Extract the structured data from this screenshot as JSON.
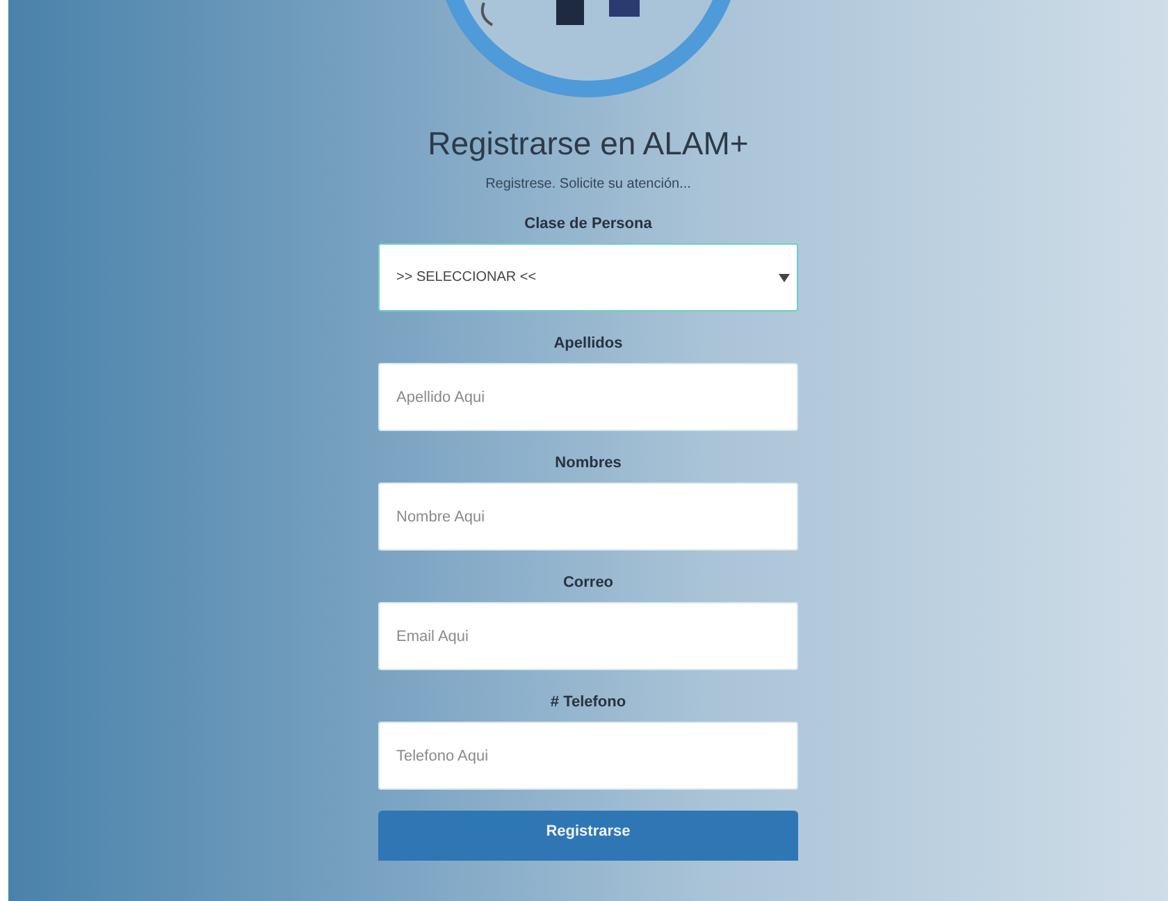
{
  "title": "Registrarse en ALAM+",
  "subtitle": "Registrese. Solicite su atención...",
  "fields": [
    {
      "label": "Clase de Persona",
      "kind": "select",
      "value": ">> SELECCIONAR <<"
    },
    {
      "label": "Apellidos",
      "kind": "input",
      "placeholder": "Apellido Aqui"
    },
    {
      "label": "Nombres",
      "kind": "input",
      "placeholder": "Nombre Aqui"
    },
    {
      "label": "Correo",
      "kind": "input",
      "placeholder": "Email Aqui"
    },
    {
      "label": "# Telefono",
      "kind": "input",
      "placeholder": "Telefono Aqui"
    }
  ],
  "button": "Registrarse"
}
